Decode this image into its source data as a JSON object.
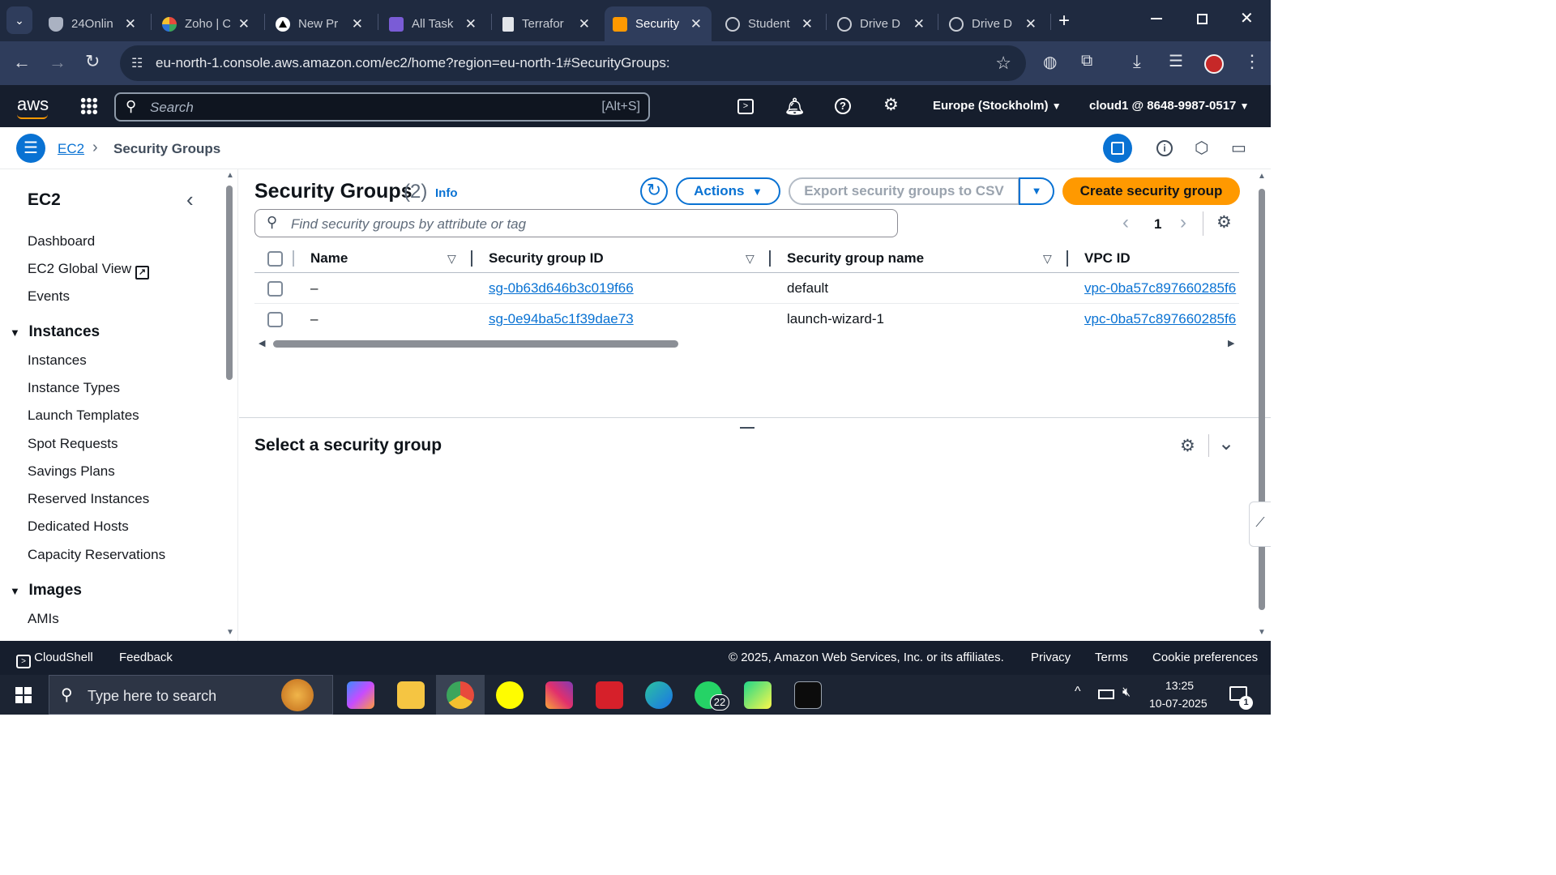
{
  "browser": {
    "tabs": [
      {
        "title": "24Onlin",
        "icon": "24online-icon",
        "color": "#c8ccd4"
      },
      {
        "title": "Zoho | C",
        "icon": "zoho-icon",
        "color": "#e0b13a"
      },
      {
        "title": "New Pr",
        "icon": "triangle-icon",
        "color": "#ffffff"
      },
      {
        "title": "All Task",
        "icon": "tasks-icon",
        "color": "#7a5cd6"
      },
      {
        "title": "Terrafor",
        "icon": "terraform-icon",
        "color": "#c8ccd4"
      },
      {
        "title": "Security",
        "icon": "aws-icon",
        "color": "#ff9900",
        "active": true
      },
      {
        "title": "Student",
        "icon": "globe-icon",
        "color": "#c8ccd4"
      },
      {
        "title": "Drive D",
        "icon": "globe-icon",
        "color": "#c8ccd4"
      },
      {
        "title": "Drive D",
        "icon": "globe-icon",
        "color": "#c8ccd4"
      }
    ],
    "url": "eu-north-1.console.aws.amazon.com/ec2/home?region=eu-north-1#SecurityGroups:"
  },
  "aws_header": {
    "logo": "aws",
    "search_placeholder": "Search",
    "search_shortcut": "[Alt+S]",
    "region": "Europe (Stockholm)",
    "account": "cloud1 @ 8648-9987-0517"
  },
  "breadcrumb": {
    "root": "EC2",
    "current": "Security Groups"
  },
  "sidebar": {
    "title": "EC2",
    "items": [
      "Dashboard",
      "EC2 Global View",
      "Events"
    ],
    "sections": [
      {
        "label": "Instances",
        "items": [
          "Instances",
          "Instance Types",
          "Launch Templates",
          "Spot Requests",
          "Savings Plans",
          "Reserved Instances",
          "Dedicated Hosts",
          "Capacity Reservations"
        ]
      },
      {
        "label": "Images",
        "items": [
          "AMIs"
        ]
      }
    ]
  },
  "main": {
    "title": "Security Groups",
    "count": "(2)",
    "info": "Info",
    "actions_label": "Actions",
    "export_label": "Export security groups to CSV",
    "create_label": "Create security group",
    "filter_placeholder": "Find security groups by attribute or tag",
    "page": "1",
    "columns": [
      "Name",
      "Security group ID",
      "Security group name",
      "VPC ID"
    ],
    "rows": [
      {
        "name": "–",
        "id": "sg-0b63d646b3c019f66",
        "group_name": "default",
        "vpc": "vpc-0ba57c897660285f6"
      },
      {
        "name": "–",
        "id": "sg-0e94ba5c1f39dae73",
        "group_name": "launch-wizard-1",
        "vpc": "vpc-0ba57c897660285f6"
      }
    ],
    "detail_title": "Select a security group"
  },
  "footer": {
    "cloudshell": "CloudShell",
    "feedback": "Feedback",
    "copyright": "© 2025, Amazon Web Services, Inc. or its affiliates.",
    "privacy": "Privacy",
    "terms": "Terms",
    "cookies": "Cookie preferences"
  },
  "taskbar": {
    "search_placeholder": "Type here to search",
    "whatsapp_badge": "22",
    "time": "13:25",
    "date": "10-07-2025",
    "notifications": "1"
  },
  "colors": {
    "accent": "#0972d3",
    "primary_button": "#ff9900",
    "aws_header": "#161e2d"
  }
}
